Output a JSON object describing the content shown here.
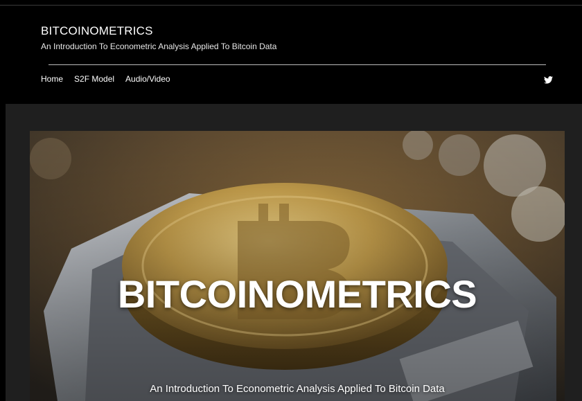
{
  "header": {
    "site_title": "BITCOINOMETRICS",
    "tagline": "An Introduction To Econometric Analysis Applied To Bitcoin Data"
  },
  "nav": {
    "items": [
      {
        "label": "Home"
      },
      {
        "label": "S2F Model"
      },
      {
        "label": "Audio/Video"
      }
    ],
    "social_icon": "twitter-icon"
  },
  "hero": {
    "title": "BITCOINOMETRICS",
    "subtitle": "An Introduction To Econometric Analysis Applied To Bitcoin Data",
    "image_subject": "gold bitcoin coin on a computer chip socket"
  },
  "colors": {
    "page_background": "#000000",
    "content_background": "#1f1f1f",
    "text": "#ffffff",
    "coin_gold": "#c9a24e"
  }
}
